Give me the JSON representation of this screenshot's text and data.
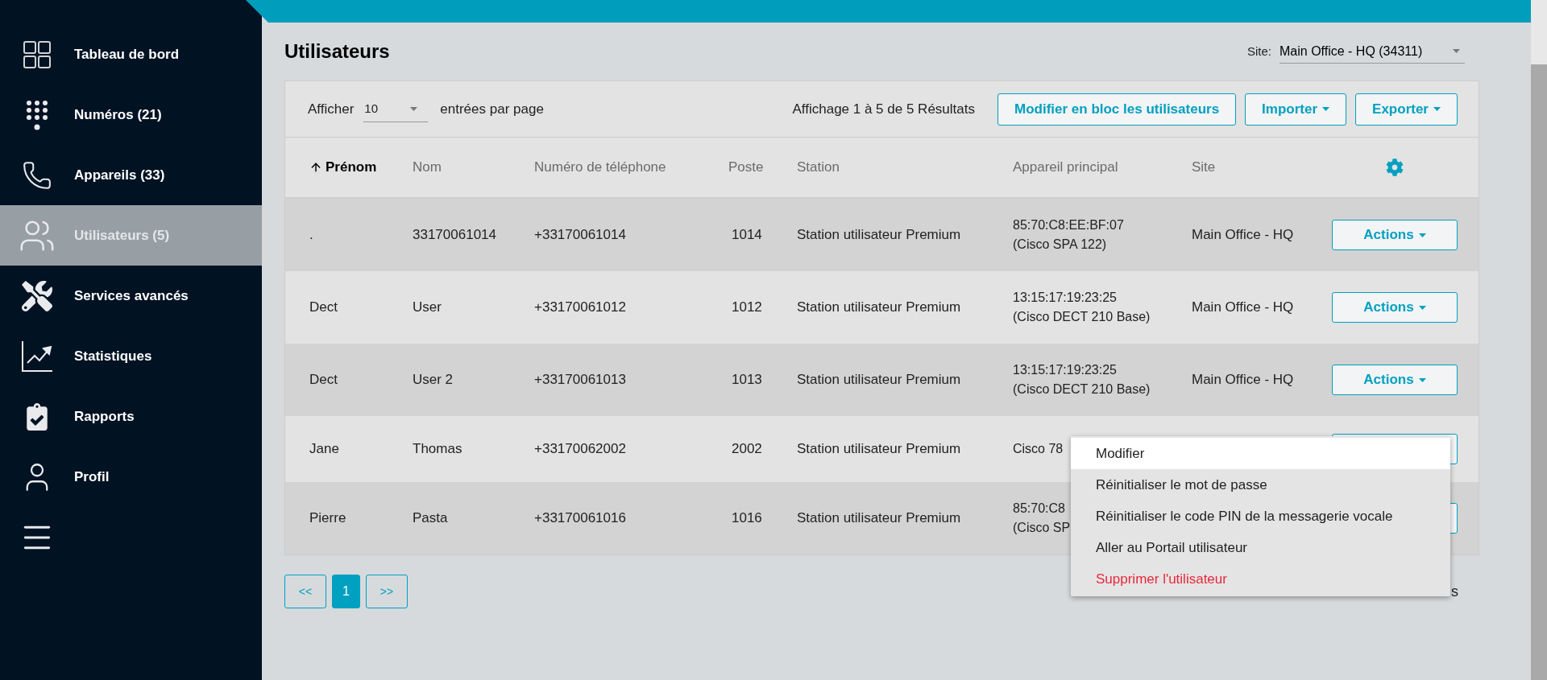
{
  "sidebar": {
    "items": [
      {
        "label": "Tableau de bord",
        "selected": false
      },
      {
        "label": "Numéros (21)",
        "selected": false
      },
      {
        "label": "Appareils (33)",
        "selected": false
      },
      {
        "label": "Utilisateurs (5)",
        "selected": true
      },
      {
        "label": "Services avancés",
        "selected": false
      },
      {
        "label": "Statistiques",
        "selected": false
      },
      {
        "label": "Rapports",
        "selected": false
      },
      {
        "label": "Profil",
        "selected": false
      }
    ]
  },
  "page": {
    "title": "Utilisateurs",
    "site_label": "Site:",
    "site_value": "Main Office - HQ (34311)"
  },
  "toolbar": {
    "show_label": "Afficher",
    "page_size": "10",
    "per_page_label": "entrées par page",
    "results": "Affichage 1 à 5 de 5 Résultats",
    "buttons": [
      {
        "label": "Modifier en bloc les utilisateurs",
        "dropdown": false
      },
      {
        "label": "Importer",
        "dropdown": true
      },
      {
        "label": "Exporter",
        "dropdown": true
      }
    ]
  },
  "table": {
    "columns": [
      {
        "label": "Prénom",
        "sorted": true
      },
      {
        "label": "Nom",
        "sorted": false
      },
      {
        "label": "Numéro de téléphone",
        "sorted": false
      },
      {
        "label": "Poste",
        "sorted": false
      },
      {
        "label": "Station",
        "sorted": false
      },
      {
        "label": "Appareil principal",
        "sorted": false
      },
      {
        "label": "Site",
        "sorted": false
      }
    ],
    "rows": [
      {
        "first_name": ".",
        "last_name": "33170061014",
        "phone": "+33170061014",
        "extension": "1014",
        "station": "Station utilisateur Premium",
        "device": [
          "85:70:C8:EE:BF:07",
          "(Cisco SPA 122)"
        ],
        "site": "Main Office - HQ",
        "action": "Actions"
      },
      {
        "first_name": "Dect",
        "last_name": "User",
        "phone": "+33170061012",
        "extension": "1012",
        "station": "Station utilisateur Premium",
        "device": [
          "13:15:17:19:23:25",
          "(Cisco DECT 210 Base)"
        ],
        "site": "Main Office - HQ",
        "action": "Actions"
      },
      {
        "first_name": "Dect",
        "last_name": "User 2",
        "phone": "+33170061013",
        "extension": "1013",
        "station": "Station utilisateur Premium",
        "device": [
          "13:15:17:19:23:25",
          "(Cisco DECT 210 Base)"
        ],
        "site": "Main Office - HQ",
        "action": "Actions"
      },
      {
        "first_name": "Jane",
        "last_name": "Thomas",
        "phone": "+33170062002",
        "extension": "2002",
        "station": "Station utilisateur Premium",
        "device": [
          "Cisco 78"
        ]
      },
      {
        "first_name": "Pierre",
        "last_name": "Pasta",
        "phone": "+33170061016",
        "extension": "1016",
        "station": "Station utilisateur Premium",
        "device": [
          "85:70:C8",
          "(Cisco SP"
        ]
      }
    ]
  },
  "pagination": {
    "first": "<<",
    "pages": [
      {
        "label": "1",
        "selected": true
      }
    ],
    "last": ">>",
    "summary": "s"
  },
  "actions_menu": {
    "items": [
      {
        "label": "Modifier",
        "kind": "normal",
        "selected": true
      },
      {
        "label": "Réinitialiser le mot de passe",
        "kind": "normal",
        "selected": false
      },
      {
        "label": "Réinitialiser le code PIN de la messagerie vocale",
        "kind": "normal",
        "selected": false
      },
      {
        "label": "Aller au Portail utilisateur",
        "kind": "normal",
        "selected": false
      },
      {
        "label": "Supprimer l'utilisateur",
        "kind": "danger",
        "selected": false
      }
    ]
  }
}
